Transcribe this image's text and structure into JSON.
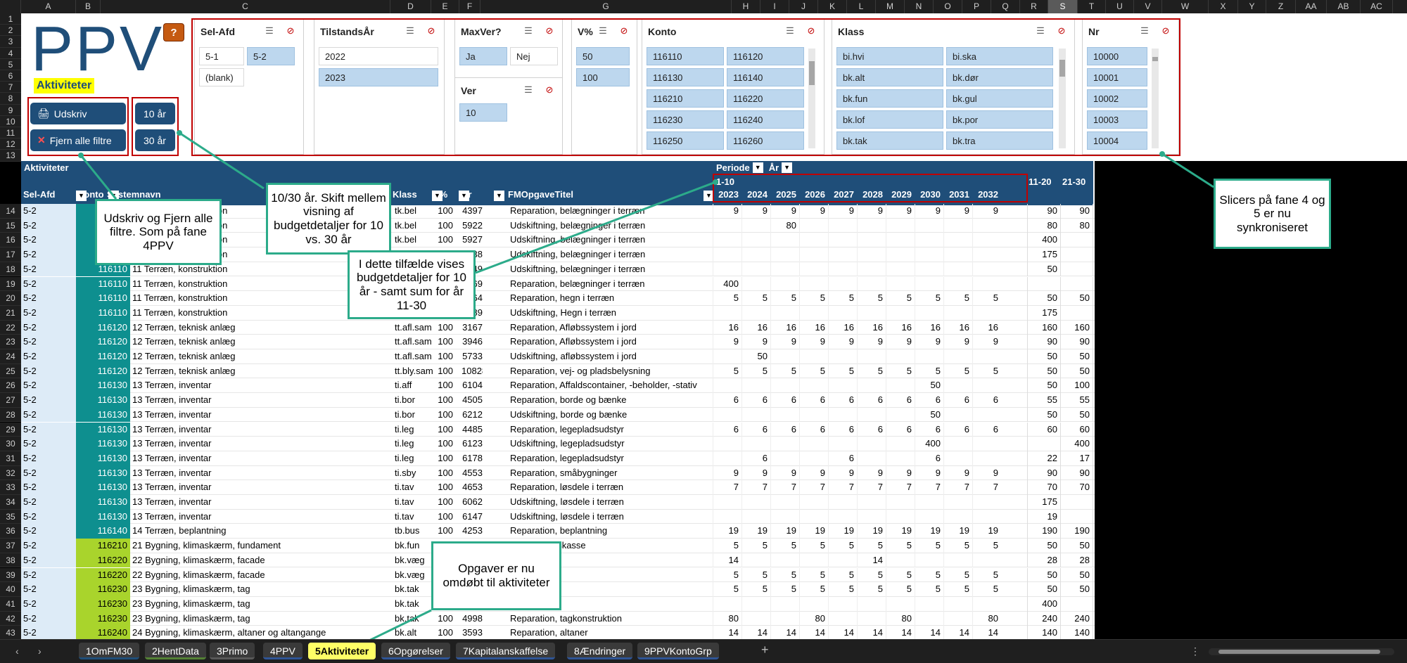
{
  "columns": [
    "A",
    "B",
    "C",
    "D",
    "E",
    "F",
    "G",
    "H",
    "I",
    "J",
    "K",
    "L",
    "M",
    "N",
    "O",
    "P",
    "Q",
    "R",
    "S",
    "T",
    "U",
    "V",
    "W",
    "X",
    "Y",
    "Z",
    "AA",
    "AB",
    "AC"
  ],
  "selected_column": "S",
  "rows_top": [
    "1",
    "2",
    "3",
    "4",
    "5",
    "6",
    "7",
    "8",
    "9",
    "10",
    "11",
    "12",
    "13"
  ],
  "logo": "PPV",
  "help_label": "?",
  "aktiviteter_label": "Aktiviteter",
  "buttons": {
    "print": "Udskriv",
    "clear": "Fjern alle filtre",
    "y10": "10 år",
    "y30": "30 år"
  },
  "slicers": {
    "selafd": {
      "title": "Sel-Afd",
      "items": [
        "5-1",
        "5-2",
        "(blank)"
      ]
    },
    "tilstand": {
      "title": "TilstandsÅr",
      "items": [
        "2022",
        "2023"
      ]
    },
    "maxver": {
      "title": "MaxVer?",
      "items": [
        "Ja",
        "Nej"
      ]
    },
    "ver": {
      "title": "Ver",
      "items": [
        "10"
      ]
    },
    "vpct": {
      "title": "V%",
      "items": [
        "50",
        "100"
      ]
    },
    "konto": {
      "title": "Konto",
      "items": [
        "116110",
        "116120",
        "116130",
        "116140",
        "116210",
        "116220",
        "116230",
        "116240",
        "116250",
        "116260"
      ]
    },
    "klass": {
      "title": "Klass",
      "items": [
        "bi.hvi",
        "bi.ska",
        "bk.alt",
        "bk.dør",
        "bk.fun",
        "bk.gul",
        "bk.lof",
        "bk.por",
        "bk.tak",
        "bk.tra"
      ]
    },
    "nr": {
      "title": "Nr",
      "items": [
        "10000",
        "10001",
        "10002",
        "10003",
        "10004"
      ]
    }
  },
  "table": {
    "title": "Aktiviteter",
    "periode": "Periode",
    "aar": "År",
    "period_1_10": "1-10",
    "period_11_20": "11-20",
    "period_21_30": "21-30",
    "headers": {
      "selafd": "Sel-Afd",
      "konto": "Konto",
      "system": "Systemnavn",
      "klass": "Klass",
      "vpct": "V%",
      "nr": "Nr",
      "titel": "FMOpgaveTitel"
    },
    "years": [
      "2023",
      "2024",
      "2025",
      "2026",
      "2027",
      "2028",
      "2029",
      "2030",
      "2031",
      "2032"
    ],
    "rows": [
      {
        "r": "14",
        "afd": "5-2",
        "konto": "116110",
        "sys": "11 Terræn, konstruktion",
        "klass": "tk.bel",
        "v": "100",
        "nr": "4397",
        "titel": "Reparation, belægninger i terræn",
        "y": [
          "9",
          "9",
          "9",
          "9",
          "9",
          "9",
          "9",
          "9",
          "9",
          "9"
        ],
        "p2": "90",
        "p3": "90",
        "kc": "teal"
      },
      {
        "r": "15",
        "afd": "5-2",
        "konto": "116110",
        "sys": "11 Terræn, konstruktion",
        "klass": "tk.bel",
        "v": "100",
        "nr": "5922",
        "titel": "Udskiftning, belægninger i terræn",
        "y": [
          "",
          "",
          "80",
          "",
          "",
          "",
          "",
          "",
          "",
          ""
        ],
        "p2": "80",
        "p3": "80",
        "kc": "teal"
      },
      {
        "r": "16",
        "afd": "5-2",
        "konto": "116110",
        "sys": "11 Terræn, konstruktion",
        "klass": "tk.bel",
        "v": "100",
        "nr": "5927",
        "titel": "Udskiftning, belægninger i terræn",
        "y": [
          "",
          "",
          "",
          "",
          "",
          "",
          "",
          "",
          "",
          ""
        ],
        "p2": "400",
        "p3": "",
        "kc": "teal"
      },
      {
        "r": "17",
        "afd": "5-2",
        "konto": "116110",
        "sys": "11 Terræn, konstruktion",
        "klass": "tk.bel",
        "v": "100",
        "nr": "5938",
        "titel": "Udskiftning, belægninger i terræn",
        "y": [
          "",
          "",
          "",
          "",
          "",
          "",
          "",
          "",
          "",
          ""
        ],
        "p2": "175",
        "p3": "",
        "kc": "teal"
      },
      {
        "r": "18",
        "afd": "5-2",
        "konto": "116110",
        "sys": "11 Terræn, konstruktion",
        "klass": "tk.bel",
        "v": "100",
        "nr": "5949",
        "titel": "Udskiftning, belægninger i terræn",
        "y": [
          "",
          "",
          "",
          "",
          "",
          "",
          "",
          "",
          "",
          ""
        ],
        "p2": "50",
        "p3": "",
        "kc": "teal"
      },
      {
        "r": "19",
        "afd": "5-2",
        "konto": "116110",
        "sys": "11 Terræn, konstruktion",
        "klass": "tk.bel",
        "v": "100",
        "nr": "5969",
        "titel": "Reparation, belægninger i terræn",
        "y": [
          "400",
          "",
          "",
          "",
          "",
          "",
          "",
          "",
          "",
          ""
        ],
        "p2": "",
        "p3": "",
        "kc": "teal"
      },
      {
        "r": "20",
        "afd": "5-2",
        "konto": "116110",
        "sys": "11 Terræn, konstruktion",
        "klass": "tk.heg",
        "v": "100",
        "nr": "4364",
        "titel": "Reparation, hegn i terræn",
        "y": [
          "5",
          "5",
          "5",
          "5",
          "5",
          "5",
          "5",
          "5",
          "5",
          "5"
        ],
        "p2": "50",
        "p3": "50",
        "kc": "teal"
      },
      {
        "r": "21",
        "afd": "5-2",
        "konto": "116110",
        "sys": "11 Terræn, konstruktion",
        "klass": "tk.heg",
        "v": "100",
        "nr": "5889",
        "titel": "Udskiftning, Hegn i terræn",
        "y": [
          "",
          "",
          "",
          "",
          "",
          "",
          "",
          "",
          "",
          ""
        ],
        "p2": "175",
        "p3": "",
        "kc": "teal"
      },
      {
        "r": "22",
        "afd": "5-2",
        "konto": "116120",
        "sys": "12 Terræn, teknisk anlæg",
        "klass": "tt.afl.sam",
        "v": "100",
        "nr": "3167",
        "titel": "Reparation, Afløbssystem i jord",
        "y": [
          "16",
          "16",
          "16",
          "16",
          "16",
          "16",
          "16",
          "16",
          "16",
          "16"
        ],
        "p2": "160",
        "p3": "160",
        "kc": "teal"
      },
      {
        "r": "23",
        "afd": "5-2",
        "konto": "116120",
        "sys": "12 Terræn, teknisk anlæg",
        "klass": "tt.afl.sam",
        "v": "100",
        "nr": "3946",
        "titel": "Reparation, Afløbssystem i jord",
        "y": [
          "9",
          "9",
          "9",
          "9",
          "9",
          "9",
          "9",
          "9",
          "9",
          "9"
        ],
        "p2": "90",
        "p3": "90",
        "kc": "teal"
      },
      {
        "r": "24",
        "afd": "5-2",
        "konto": "116120",
        "sys": "12 Terræn, teknisk anlæg",
        "klass": "tt.afl.sam",
        "v": "100",
        "nr": "5733",
        "titel": "Udskiftning, afløbssystem i jord",
        "y": [
          "",
          "50",
          "",
          "",
          "",
          "",
          "",
          "",
          "",
          ""
        ],
        "p2": "50",
        "p3": "50",
        "kc": "teal"
      },
      {
        "r": "25",
        "afd": "5-2",
        "konto": "116120",
        "sys": "12 Terræn, teknisk anlæg",
        "klass": "tt.bly.sam",
        "v": "100",
        "nr": "10828",
        "titel": "Reparation, vej- og pladsbelysning",
        "y": [
          "5",
          "5",
          "5",
          "5",
          "5",
          "5",
          "5",
          "5",
          "5",
          "5"
        ],
        "p2": "50",
        "p3": "50",
        "kc": "teal"
      },
      {
        "r": "26",
        "afd": "5-2",
        "konto": "116130",
        "sys": "13 Terræn, inventar",
        "klass": "ti.aff",
        "v": "100",
        "nr": "6104",
        "titel": "Reparation, Affaldscontainer, -beholder, -stativ",
        "y": [
          "",
          "",
          "",
          "",
          "",
          "",
          "",
          "50",
          "",
          ""
        ],
        "p2": "50",
        "p3": "100",
        "kc": "teal"
      },
      {
        "r": "27",
        "afd": "5-2",
        "konto": "116130",
        "sys": "13 Terræn, inventar",
        "klass": "ti.bor",
        "v": "100",
        "nr": "4505",
        "titel": "Reparation, borde og bænke",
        "y": [
          "6",
          "6",
          "6",
          "6",
          "6",
          "6",
          "6",
          "6",
          "6",
          "6"
        ],
        "p2": "55",
        "p3": "55",
        "kc": "teal"
      },
      {
        "r": "28",
        "afd": "5-2",
        "konto": "116130",
        "sys": "13 Terræn, inventar",
        "klass": "ti.bor",
        "v": "100",
        "nr": "6212",
        "titel": "Udskiftning, borde og bænke",
        "y": [
          "",
          "",
          "",
          "",
          "",
          "",
          "",
          "50",
          "",
          ""
        ],
        "p2": "50",
        "p3": "50",
        "kc": "teal"
      },
      {
        "r": "29",
        "afd": "5-2",
        "konto": "116130",
        "sys": "13 Terræn, inventar",
        "klass": "ti.leg",
        "v": "100",
        "nr": "4485",
        "titel": "Reparation, legepladsudstyr",
        "y": [
          "6",
          "6",
          "6",
          "6",
          "6",
          "6",
          "6",
          "6",
          "6",
          "6"
        ],
        "p2": "60",
        "p3": "60",
        "kc": "teal"
      },
      {
        "r": "30",
        "afd": "5-2",
        "konto": "116130",
        "sys": "13 Terræn, inventar",
        "klass": "ti.leg",
        "v": "100",
        "nr": "6123",
        "titel": "Udskiftning, legepladsudstyr",
        "y": [
          "",
          "",
          "",
          "",
          "",
          "",
          "",
          "400",
          "",
          ""
        ],
        "p2": "",
        "p3": "400",
        "kc": "teal"
      },
      {
        "r": "31",
        "afd": "5-2",
        "konto": "116130",
        "sys": "13 Terræn, inventar",
        "klass": "ti.leg",
        "v": "100",
        "nr": "6178",
        "titel": "Reparation, legepladsudstyr",
        "y": [
          "",
          "6",
          "",
          "",
          "6",
          "",
          "",
          "6",
          "",
          ""
        ],
        "p2": "22",
        "p3": "17",
        "kc": "teal"
      },
      {
        "r": "32",
        "afd": "5-2",
        "konto": "116130",
        "sys": "13 Terræn, inventar",
        "klass": "ti.sby",
        "v": "100",
        "nr": "4553",
        "titel": "Reparation, småbygninger",
        "y": [
          "9",
          "9",
          "9",
          "9",
          "9",
          "9",
          "9",
          "9",
          "9",
          "9"
        ],
        "p2": "90",
        "p3": "90",
        "kc": "teal"
      },
      {
        "r": "33",
        "afd": "5-2",
        "konto": "116130",
        "sys": "13 Terræn, inventar",
        "klass": "ti.tav",
        "v": "100",
        "nr": "4653",
        "titel": "Reparation, løsdele i terræn",
        "y": [
          "7",
          "7",
          "7",
          "7",
          "7",
          "7",
          "7",
          "7",
          "7",
          "7"
        ],
        "p2": "70",
        "p3": "70",
        "kc": "teal"
      },
      {
        "r": "34",
        "afd": "5-2",
        "konto": "116130",
        "sys": "13 Terræn, inventar",
        "klass": "ti.tav",
        "v": "100",
        "nr": "6062",
        "titel": "Udskiftning, løsdele i terræn",
        "y": [
          "",
          "",
          "",
          "",
          "",
          "",
          "",
          "",
          "",
          ""
        ],
        "p2": "175",
        "p3": "",
        "kc": "teal"
      },
      {
        "r": "35",
        "afd": "5-2",
        "konto": "116130",
        "sys": "13 Terræn, inventar",
        "klass": "ti.tav",
        "v": "100",
        "nr": "6147",
        "titel": "Udskiftning, løsdele i terræn",
        "y": [
          "",
          "",
          "",
          "",
          "",
          "",
          "",
          "",
          "",
          ""
        ],
        "p2": "19",
        "p3": "",
        "kc": "teal"
      },
      {
        "r": "36",
        "afd": "5-2",
        "konto": "116140",
        "sys": "14 Terræn, beplantning",
        "klass": "tb.bus",
        "v": "100",
        "nr": "4253",
        "titel": "Reparation, beplantning",
        "y": [
          "19",
          "19",
          "19",
          "19",
          "19",
          "19",
          "19",
          "19",
          "19",
          "19"
        ],
        "p2": "190",
        "p3": "190",
        "kc": "teal"
      },
      {
        "r": "37",
        "afd": "5-2",
        "konto": "116210",
        "sys": "21 Bygning, klimaskærm, fundament",
        "klass": "bk.fun",
        "v": "100",
        "nr": "",
        "titel": "ament og lyskasse",
        "y": [
          "5",
          "5",
          "5",
          "5",
          "5",
          "5",
          "5",
          "5",
          "5",
          "5"
        ],
        "p2": "50",
        "p3": "50",
        "kc": "lime"
      },
      {
        "r": "38",
        "afd": "5-2",
        "konto": "116220",
        "sys": "22 Bygning, klimaskærm, facade",
        "klass": "bk.væg",
        "v": "100",
        "nr": "",
        "titel": "væg",
        "y": [
          "14",
          "",
          "",
          "",
          "",
          "14",
          "",
          "",
          "",
          ""
        ],
        "p2": "28",
        "p3": "28",
        "kc": "lime"
      },
      {
        "r": "39",
        "afd": "5-2",
        "konto": "116220",
        "sys": "22 Bygning, klimaskærm, facade",
        "klass": "bk.væg",
        "v": "100",
        "nr": "",
        "titel": "væg",
        "y": [
          "5",
          "5",
          "5",
          "5",
          "5",
          "5",
          "5",
          "5",
          "5",
          "5"
        ],
        "p2": "50",
        "p3": "50",
        "kc": "lime"
      },
      {
        "r": "40",
        "afd": "5-2",
        "konto": "116230",
        "sys": "23 Bygning, klimaskærm, tag",
        "klass": "bk.tak",
        "v": "100",
        "nr": "",
        "titel": "onstruktion",
        "y": [
          "5",
          "5",
          "5",
          "5",
          "5",
          "5",
          "5",
          "5",
          "5",
          "5"
        ],
        "p2": "50",
        "p3": "50",
        "kc": "lime"
      },
      {
        "r": "41",
        "afd": "5-2",
        "konto": "116230",
        "sys": "23 Bygning, klimaskærm, tag",
        "klass": "bk.tak",
        "v": "100",
        "nr": "",
        "titel": "onstruktion",
        "y": [
          "",
          "",
          "",
          "",
          "",
          "",
          "",
          "",
          "",
          ""
        ],
        "p2": "400",
        "p3": "",
        "kc": "lime"
      },
      {
        "r": "42",
        "afd": "5-2",
        "konto": "116230",
        "sys": "23 Bygning, klimaskærm, tag",
        "klass": "bk.tak",
        "v": "100",
        "nr": "4998",
        "titel": "Reparation, tagkonstruktion",
        "y": [
          "80",
          "",
          "",
          "80",
          "",
          "",
          "80",
          "",
          "",
          "80"
        ],
        "p2": "240",
        "p3": "240",
        "kc": "lime"
      },
      {
        "r": "43",
        "afd": "5-2",
        "konto": "116240",
        "sys": "24 Bygning, klimaskærm, altaner og altangange",
        "klass": "bk.alt",
        "v": "100",
        "nr": "3593",
        "titel": "Reparation, altaner",
        "y": [
          "14",
          "14",
          "14",
          "14",
          "14",
          "14",
          "14",
          "14",
          "14",
          "14"
        ],
        "p2": "140",
        "p3": "140",
        "kc": "lime"
      }
    ]
  },
  "callouts": {
    "c1": "Udskriv og Fjern alle filtre. Som på fane 4PPV",
    "c2": "10/30 år. Skift mellem visning af budgetdetaljer for 10 vs. 30 år",
    "c3": "I dette tilfælde vises budgetdetaljer for 10 år - samt sum for år 11-30",
    "c4": "Slicers på fane 4 og 5 er nu synkroniseret",
    "c5": "Opgaver er nu omdøbt til aktiviteter"
  },
  "tabs": [
    {
      "label": "1OmFM30",
      "color": "#1f4e79"
    },
    {
      "label": "2HentData",
      "color": "#548235"
    },
    {
      "label": "3Primo",
      "color": "#595959"
    },
    {
      "label": "4PPV",
      "color": "#2f5597"
    },
    {
      "label": "5Aktiviteter",
      "color": "#ffff66",
      "active": true
    },
    {
      "label": "6Opgørelser",
      "color": "#2f5597"
    },
    {
      "label": "7Kapitalanskaffelse",
      "color": "#2f5597"
    },
    {
      "label": "8Ændringer",
      "color": "#2f5597"
    },
    {
      "label": "9PPVKontoGrp",
      "color": "#2f5597"
    }
  ],
  "colors": {
    "header_blue": "#1f4e79",
    "teal": "#0e8f8f",
    "lime": "#a9d42c",
    "callout_border": "#2cab8a",
    "red_frame": "#c00000",
    "selected_slicer": "#bdd7ee"
  }
}
